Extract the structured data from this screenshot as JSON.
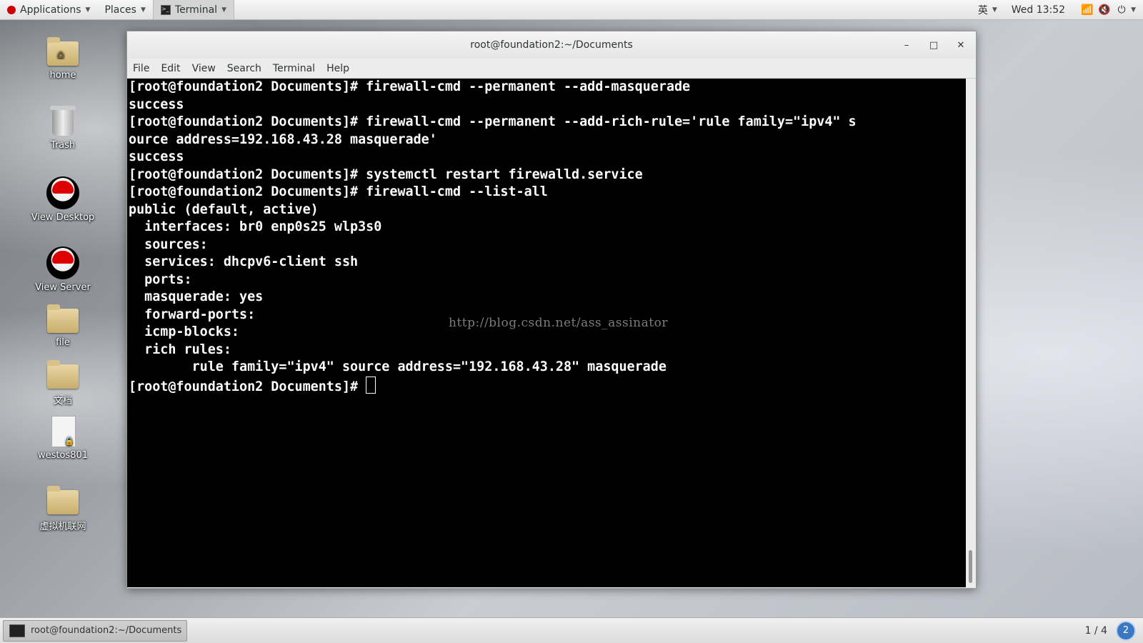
{
  "top_panel": {
    "applications": "Applications",
    "places": "Places",
    "terminal": "Terminal",
    "input_method": "英",
    "clock": "Wed 13:52",
    "icons": [
      "wifi-icon",
      "volume-muted-icon",
      "power-icon"
    ]
  },
  "desktop_icons": [
    {
      "label": "home",
      "icon": "home-folder-icon"
    },
    {
      "label": "Trash",
      "icon": "trash-icon"
    },
    {
      "label": "View Desktop",
      "icon": "redhat-icon"
    },
    {
      "label": "View Server",
      "icon": "redhat-icon"
    },
    {
      "label": "file",
      "icon": "folder-icon"
    },
    {
      "label": "文档",
      "icon": "folder-icon"
    },
    {
      "label": "westos801",
      "icon": "locked-document-icon"
    },
    {
      "label": "虚拟机联网",
      "icon": "folder-icon"
    }
  ],
  "window": {
    "title": "root@foundation2:~/Documents",
    "buttons": {
      "minimize": "–",
      "maximize": "□",
      "close": "✕"
    },
    "menu": [
      "File",
      "Edit",
      "View",
      "Search",
      "Terminal",
      "Help"
    ]
  },
  "terminal": {
    "lines": [
      "[root@foundation2 Documents]# firewall-cmd --permanent --add-masquerade",
      "success",
      "[root@foundation2 Documents]# firewall-cmd --permanent --add-rich-rule='rule family=\"ipv4\" s",
      "ource address=192.168.43.28 masquerade'",
      "success",
      "[root@foundation2 Documents]# systemctl restart firewalld.service",
      "[root@foundation2 Documents]# firewall-cmd --list-all",
      "public (default, active)",
      "  interfaces: br0 enp0s25 wlp3s0",
      "  sources: ",
      "  services: dhcpv6-client ssh",
      "  ports: ",
      "  masquerade: yes",
      "  forward-ports: ",
      "  icmp-blocks: ",
      "  rich rules: ",
      "        rule family=\"ipv4\" source address=\"192.168.43.28\" masquerade"
    ],
    "prompt": "[root@foundation2 Documents]# ",
    "watermark": "http://blog.csdn.net/ass_assinator"
  },
  "bottom_panel": {
    "task": "root@foundation2:~/Documents",
    "workspace": "1 / 4",
    "badge": "2"
  }
}
